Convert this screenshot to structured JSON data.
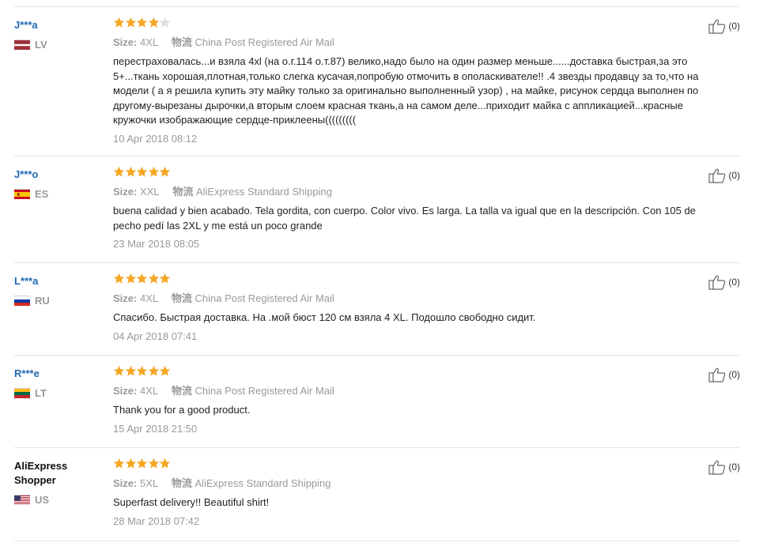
{
  "colors": {
    "star_on": "#f5a623",
    "star_off": "#dddddd",
    "name_link": "#1f68b3",
    "muted": "#999999"
  },
  "labels": {
    "size": "Size:",
    "logistics": "物流"
  },
  "reviews": [
    {
      "name": "J***a",
      "name_is_link": true,
      "country": "LV",
      "stars": 4,
      "size": "4XL",
      "shipping": "China Post Registered Air Mail",
      "text": "перестраховалась...и взяла 4xl (на о.г.114 о.т.87) велико,надо было на один размер меньше......доставка быстрая,за это 5+...ткань хорошая,плотная,только слегка кусачая,попробую отмочить в ополаскивателе!! .4 звезды продавцу за то,что на модели ( а я решила купить эту майку только за оригинально выполненный узор) , на майке, рисунок сердца выполнен по другому-вырезаны дырочки,а вторым слоем красная ткань,а на самом деле...приходит майка с аппликацией...красные кружочки изображающие сердце-приклеены(((((((((",
      "date": "10 Apr 2018 08:12",
      "helpful": "(0)"
    },
    {
      "name": "J***o",
      "name_is_link": true,
      "country": "ES",
      "stars": 5,
      "size": "XXL",
      "shipping": "AliExpress Standard Shipping",
      "text": "buena calidad y bien acabado. Tela gordita, con cuerpo. Color vivo. Es larga. La talla va igual que en la descripción. Con 105 de pecho pedí las 2XL y me está un poco grande",
      "date": "23 Mar 2018 08:05",
      "helpful": "(0)"
    },
    {
      "name": "L***a",
      "name_is_link": true,
      "country": "RU",
      "stars": 5,
      "size": "4XL",
      "shipping": "China Post Registered Air Mail",
      "text": "Спасибо. Быстрая доставка. На .мой бюст 120 см взяла 4 XL. Подошло свободно сидит.",
      "date": "04 Apr 2018 07:41",
      "helpful": "(0)"
    },
    {
      "name": "R***e",
      "name_is_link": true,
      "country": "LT",
      "stars": 5,
      "size": "4XL",
      "shipping": "China Post Registered Air Mail",
      "text": "Thank you for a good product.",
      "date": "15 Apr 2018 21:50",
      "helpful": "(0)"
    },
    {
      "name": "AliExpress Shopper",
      "name_is_link": false,
      "country": "US",
      "stars": 5,
      "size": "5XL",
      "shipping": "AliExpress Standard Shipping",
      "text": "Superfast delivery!! Beautiful shirt!",
      "date": "28 Mar 2018 07:42",
      "helpful": "(0)"
    }
  ]
}
